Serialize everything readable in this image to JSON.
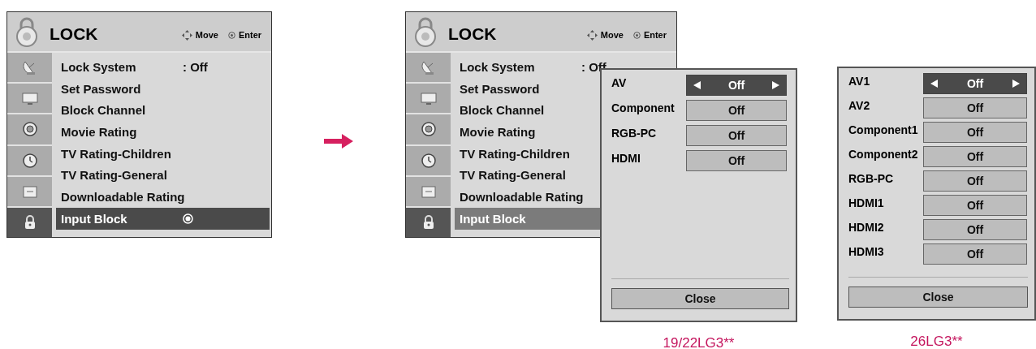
{
  "menus": [
    {
      "title": "LOCK",
      "active": true,
      "hints": [
        {
          "kind": "move",
          "label": "Move"
        },
        {
          "kind": "enter",
          "label": "Enter"
        }
      ],
      "categories": [
        {
          "kind": "satellite",
          "selected": false
        },
        {
          "kind": "tv",
          "selected": false
        },
        {
          "kind": "speaker",
          "selected": false
        },
        {
          "kind": "clock",
          "selected": false
        },
        {
          "kind": "toolbox",
          "selected": false
        },
        {
          "kind": "lock",
          "selected": true
        }
      ],
      "items": [
        {
          "label": "Lock System",
          "value": ": Off",
          "selected": false
        },
        {
          "label": "Set Password",
          "selected": false
        },
        {
          "label": "Block Channel",
          "selected": false
        },
        {
          "label": "Movie Rating",
          "selected": false
        },
        {
          "label": "TV Rating-Children",
          "selected": false
        },
        {
          "label": "TV Rating-General",
          "selected": false
        },
        {
          "label": "Downloadable Rating",
          "selected": false
        },
        {
          "label": "Input Block",
          "selected": true
        }
      ]
    },
    {
      "title": "LOCK",
      "active": false,
      "hints": [
        {
          "kind": "move",
          "label": "Move"
        },
        {
          "kind": "enter",
          "label": "Enter"
        }
      ],
      "categories": [
        {
          "kind": "satellite",
          "selected": false
        },
        {
          "kind": "tv",
          "selected": false
        },
        {
          "kind": "speaker",
          "selected": false
        },
        {
          "kind": "clock",
          "selected": false
        },
        {
          "kind": "toolbox",
          "selected": false
        },
        {
          "kind": "lock",
          "selected": true
        }
      ],
      "items": [
        {
          "label": "Lock System",
          "value": ": Off",
          "selected": false
        },
        {
          "label": "Set Password",
          "selected": false
        },
        {
          "label": "Block Channel",
          "selected": false
        },
        {
          "label": "Movie Rating",
          "selected": false
        },
        {
          "label": "TV Rating-Children",
          "selected": false
        },
        {
          "label": "TV Rating-General",
          "selected": false
        },
        {
          "label": "Downloadable Rating",
          "selected": false
        },
        {
          "label": "Input Block",
          "selected": true
        }
      ]
    }
  ],
  "popups": [
    {
      "rows": [
        {
          "label": "AV",
          "value": "Off",
          "selected": true
        },
        {
          "label": "Component",
          "value": "Off",
          "selected": false
        },
        {
          "label": "RGB-PC",
          "value": "Off",
          "selected": false
        },
        {
          "label": "HDMI",
          "value": "Off",
          "selected": false
        }
      ],
      "close": "Close",
      "caption": "19/22LG3**"
    },
    {
      "rows": [
        {
          "label": "AV1",
          "value": "Off",
          "selected": true
        },
        {
          "label": "AV2",
          "value": "Off",
          "selected": false
        },
        {
          "label": "Component1",
          "value": "Off",
          "selected": false
        },
        {
          "label": "Component2",
          "value": "Off",
          "selected": false
        },
        {
          "label": "RGB-PC",
          "value": "Off",
          "selected": false
        },
        {
          "label": "HDMI1",
          "value": "Off",
          "selected": false
        },
        {
          "label": "HDMI2",
          "value": "Off",
          "selected": false
        },
        {
          "label": "HDMI3",
          "value": "Off",
          "selected": false
        }
      ],
      "close": "Close",
      "caption": "26LG3**"
    }
  ]
}
